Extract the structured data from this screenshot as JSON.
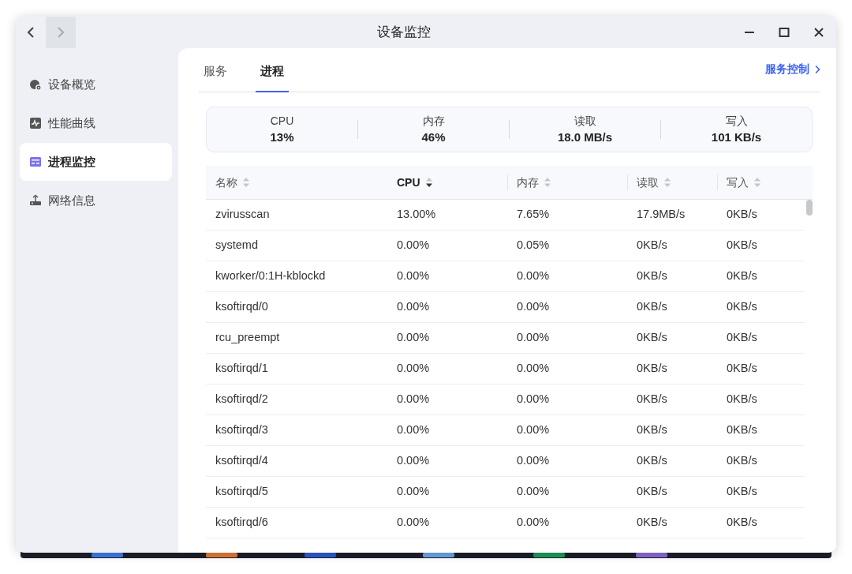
{
  "window": {
    "title": "设备监控"
  },
  "sidebar": {
    "items": [
      {
        "label": "设备概览",
        "selected": false
      },
      {
        "label": "性能曲线",
        "selected": false
      },
      {
        "label": "进程监控",
        "selected": true
      },
      {
        "label": "网络信息",
        "selected": false
      }
    ]
  },
  "tabs": [
    {
      "label": "服务",
      "selected": false
    },
    {
      "label": "进程",
      "selected": true
    }
  ],
  "service_control_link": "服务控制",
  "summary": [
    {
      "label": "CPU",
      "value": "13%"
    },
    {
      "label": "内存",
      "value": "46%"
    },
    {
      "label": "读取",
      "value": "18.0 MB/s"
    },
    {
      "label": "写入",
      "value": "101 KB/s"
    }
  ],
  "table": {
    "columns": [
      {
        "label": "名称",
        "sorted": false
      },
      {
        "label": "CPU",
        "sorted": true
      },
      {
        "label": "内存",
        "sorted": false
      },
      {
        "label": "读取",
        "sorted": false
      },
      {
        "label": "写入",
        "sorted": false
      }
    ],
    "rows": [
      [
        "zvirusscan",
        "13.00%",
        "7.65%",
        "17.9MB/s",
        "0KB/s"
      ],
      [
        "systemd",
        "0.00%",
        "0.05%",
        "0KB/s",
        "0KB/s"
      ],
      [
        "kworker/0:1H-kblockd",
        "0.00%",
        "0.00%",
        "0KB/s",
        "0KB/s"
      ],
      [
        "ksoftirqd/0",
        "0.00%",
        "0.00%",
        "0KB/s",
        "0KB/s"
      ],
      [
        "rcu_preempt",
        "0.00%",
        "0.00%",
        "0KB/s",
        "0KB/s"
      ],
      [
        "ksoftirqd/1",
        "0.00%",
        "0.00%",
        "0KB/s",
        "0KB/s"
      ],
      [
        "ksoftirqd/2",
        "0.00%",
        "0.00%",
        "0KB/s",
        "0KB/s"
      ],
      [
        "ksoftirqd/3",
        "0.00%",
        "0.00%",
        "0KB/s",
        "0KB/s"
      ],
      [
        "ksoftirqd/4",
        "0.00%",
        "0.00%",
        "0KB/s",
        "0KB/s"
      ],
      [
        "ksoftirqd/5",
        "0.00%",
        "0.00%",
        "0KB/s",
        "0KB/s"
      ],
      [
        "ksoftirqd/6",
        "0.00%",
        "0.00%",
        "0KB/s",
        "0KB/s"
      ]
    ]
  }
}
